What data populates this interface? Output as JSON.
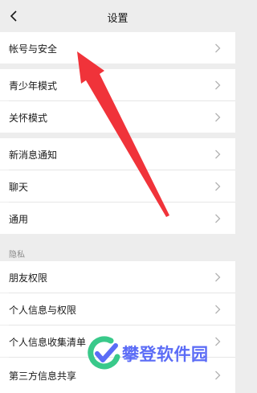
{
  "header": {
    "title": "设置",
    "back_icon": "chevron-left-icon"
  },
  "groups": {
    "account": {
      "items": [
        {
          "label": "帐号与安全"
        }
      ]
    },
    "modes": {
      "items": [
        {
          "label": "青少年模式"
        },
        {
          "label": "关怀模式"
        }
      ]
    },
    "general": {
      "items": [
        {
          "label": "新消息通知"
        },
        {
          "label": "聊天"
        },
        {
          "label": "通用"
        }
      ]
    },
    "privacy": {
      "section_label": "隐私",
      "items": [
        {
          "label": "朋友权限"
        },
        {
          "label": "个人信息与权限"
        },
        {
          "label": "个人信息收集清单"
        },
        {
          "label": "第三方信息共享"
        }
      ]
    }
  },
  "watermark": {
    "text": "攀登软件园"
  },
  "colors": {
    "background": "#ededed",
    "row": "#ffffff",
    "annotation_arrow": "#f0333a",
    "watermark_blue": "#5b6cf6",
    "watermark_green": "#39c98a"
  }
}
